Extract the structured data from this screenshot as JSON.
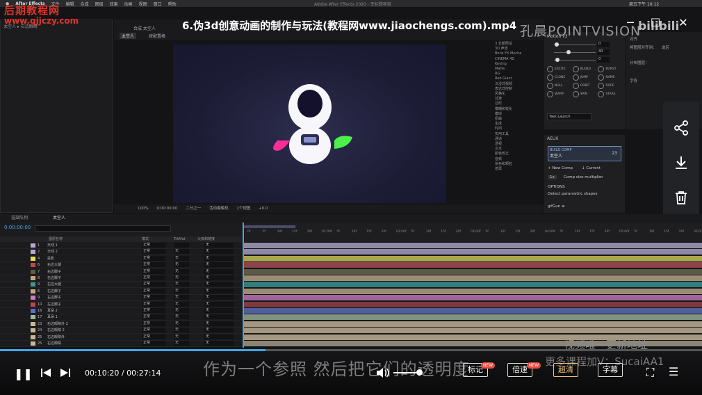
{
  "menubar": {
    "app": "After Effects",
    "items": [
      "文件",
      "编辑",
      "合成",
      "图层",
      "效果",
      "动画",
      "视图",
      "窗口",
      "帮助"
    ],
    "title": "Adobe After Effects 2020 - 无标题项目",
    "time": "周五下午 10:12"
  },
  "watermark": {
    "line1": "后期教程网",
    "line2": "www.qjjczy.com",
    "right_line1": "视频唯一更新地址",
    "right_line2": "更多课程加V：SucaiAA1"
  },
  "video": {
    "title": "6.伪3d创意动画的制作与玩法(教程网www.jiaochengs.com).mp4",
    "brand": "孔晨POINTVISION",
    "brand2": "bilibili"
  },
  "project_panel": {
    "tab": "太空人 ▸ 右边眼睛"
  },
  "comp": {
    "header": "合成 太空人",
    "tab_active": "太空人",
    "tab2": "按配置格"
  },
  "viewer_toolbar": {
    "zoom": "100%",
    "time": "0:00:00:00",
    "res": "二分之一",
    "camera": "活动摄像机",
    "views": "1个视图",
    "exposure": "+0.0"
  },
  "effects_list": [
    "3 长期预设",
    "3D 声道",
    "Boris FX Mocha",
    "CINEMA 4D",
    "Keying",
    "Matte",
    "RG",
    "Red Giant",
    "沉浸式视频",
    "表达式控制",
    "风格化",
    "过渡",
    "过时",
    "模糊和锐化",
    "模拟",
    "扭曲",
    "生成",
    "时间",
    "实用工具",
    "通道",
    "透视",
    "文本",
    "颜色校正",
    "音频",
    "杂色和颗粒",
    "遮罩"
  ],
  "motion": {
    "header": "Motion v3",
    "sliders": [
      {
        "val": "0",
        "pos": 0.06
      },
      {
        "val": "40",
        "pos": 0.35
      },
      {
        "val": "0",
        "pos": 0.08
      }
    ],
    "buttons": [
      "EXCITE",
      "BLEND",
      "BURST",
      "CLONE",
      "JUMP",
      "NAME",
      "NULL",
      "ORBIT",
      "ROPE",
      "WARP",
      "SPIN",
      "STARE"
    ],
    "task": "Task Launch"
  },
  "aeux": {
    "header": "AEUX",
    "build_label": "BUILD COMP",
    "build_name": "太空人",
    "build_count": "23",
    "new_comp": "+ New Comp",
    "current": "↓ Current",
    "scale": "1x",
    "scale_label": "Comp size multiplier",
    "options": "OPTIONS",
    "opt1": "Detect parametric shapes",
    "footer": "gifGun ≡"
  },
  "align": {
    "title": "对齐",
    "l1": "将图层对齐到：",
    "l1v": "选区",
    "l2": "分布图层：",
    "l3": "字符"
  },
  "timeline": {
    "tab1": "渲染队列",
    "tab2": "太空人",
    "timecode": "0:00:00:00",
    "cols": {
      "name": "图层名称",
      "mode": "模式",
      "trkmat": "TrkMat",
      "parent": "父级和链接"
    },
    "ticks": [
      "0f",
      "5f",
      "10f",
      "15f",
      "20f",
      "01:00f",
      "5f",
      "10f",
      "15f",
      "20f",
      "02:00f",
      "5f",
      "10f",
      "15f",
      "20f",
      "03:00f",
      "5f",
      "10f",
      "15f",
      "20f",
      "04:00f",
      "5f",
      "10f",
      "15f",
      "20f",
      "05:00f",
      "5f",
      "10f",
      "15f",
      "20f",
      "06:00f"
    ],
    "layers": [
      {
        "num": "1",
        "name": "天线 1",
        "mode": "正常",
        "trk": "",
        "parent": "无",
        "color": "#b9a6d6",
        "bar": "#8e8aa6"
      },
      {
        "num": "2",
        "name": "天线 2",
        "mode": "正常",
        "trk": "无",
        "parent": "无",
        "color": "#b9a6d6",
        "bar": "#8e8aa6"
      },
      {
        "num": "4",
        "name": "投影",
        "mode": "正常",
        "trk": "无",
        "parent": "无",
        "color": "#e6df5a",
        "bar": "#aaa64e"
      },
      {
        "num": "6",
        "name": "右边大腿",
        "mode": "正常",
        "trk": "无",
        "parent": "无",
        "color": "#c0464a",
        "bar": "#8c4448"
      },
      {
        "num": "7",
        "name": "右边脚子",
        "mode": "正常",
        "trk": "无",
        "parent": "无",
        "color": "#5b5b48",
        "bar": "#5b5b48"
      },
      {
        "num": "8",
        "name": "右边脚子",
        "mode": "正常",
        "trk": "无",
        "parent": "无",
        "color": "#c9a77d",
        "bar": "#9d8c74"
      },
      {
        "num": "9",
        "name": "右边大腿",
        "mode": "正常",
        "trk": "无",
        "parent": "无",
        "color": "#3a9b98",
        "bar": "#2f7e7c"
      },
      {
        "num": "6",
        "name": "右边脚子",
        "mode": "正常",
        "trk": "无",
        "parent": "无",
        "color": "#c9a77d",
        "bar": "#9d8c74"
      },
      {
        "num": "9",
        "name": "右边脚子",
        "mode": "正常",
        "trk": "无",
        "parent": "无",
        "color": "#d07ac8",
        "bar": "#a0659b"
      },
      {
        "num": "10",
        "name": "左边脚子",
        "mode": "正常",
        "trk": "无",
        "parent": "无",
        "color": "#c0464a",
        "bar": "#7d3b40"
      },
      {
        "num": "16",
        "name": "耳朵 2",
        "mode": "正常",
        "trk": "无",
        "parent": "无",
        "color": "#5c6fc9",
        "bar": "#50609f"
      },
      {
        "num": "17",
        "name": "耳朵 1",
        "mode": "正常",
        "trk": "无",
        "parent": "无",
        "color": "#9dbb9a",
        "bar": "#7f9380"
      },
      {
        "num": "23",
        "name": "右边眼睛外 2",
        "mode": "正常",
        "trk": "无",
        "parent": "无",
        "color": "#c9b89a",
        "bar": "#a49882"
      },
      {
        "num": "24",
        "name": "右边眼睛 2",
        "mode": "正常",
        "trk": "无",
        "parent": "无",
        "color": "#c9b89a",
        "bar": "#a49882"
      },
      {
        "num": "25",
        "name": "右边眼睛外",
        "mode": "正常",
        "trk": "无",
        "parent": "无",
        "color": "#c9b89a",
        "bar": "#a49882"
      },
      {
        "num": "25",
        "name": "右边眼睛",
        "mode": "正常",
        "trk": "无",
        "parent": "无",
        "color": "#c9b89a",
        "bar": "#8c8574"
      }
    ]
  },
  "player": {
    "progress": 0.378,
    "time": "00:10:20 / 00:27:14",
    "btn_mark": "标记",
    "btn_speed": "倍速",
    "btn_quality": "超清",
    "btn_sub": "字幕",
    "new": "NEW",
    "subtitle": "作为一个参照 然后把它们的透明度"
  },
  "icons": {
    "share": "share-icon",
    "download": "download-icon",
    "delete": "trash-icon",
    "target": "target-icon",
    "pin": "pin-icon"
  }
}
